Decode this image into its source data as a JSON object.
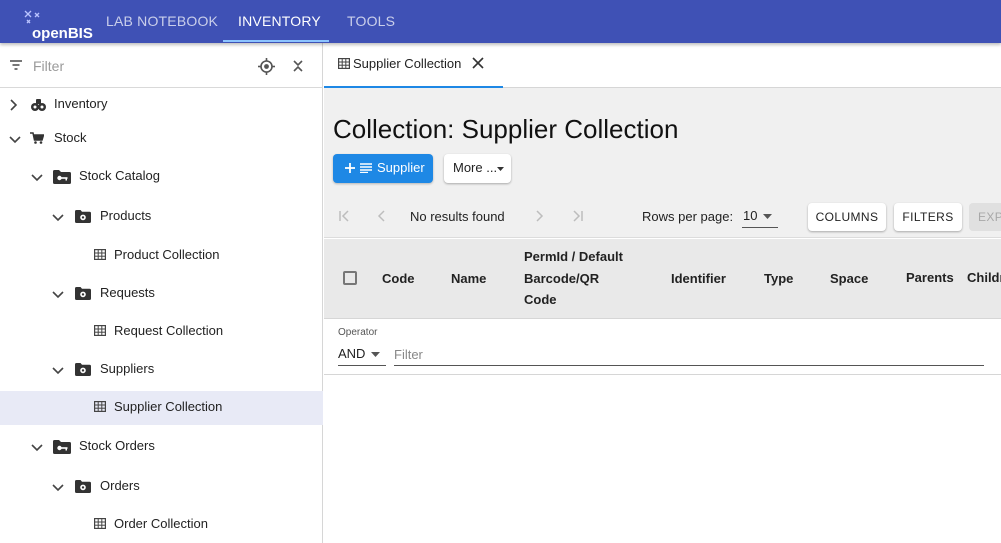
{
  "app": {
    "logo_text": "openBIS",
    "nav": [
      {
        "label": "LAB NOTEBOOK",
        "active": false
      },
      {
        "label": "INVENTORY",
        "active": true
      },
      {
        "label": "TOOLS",
        "active": false
      }
    ]
  },
  "sidebar": {
    "filter_placeholder": "Filter",
    "tree": [
      {
        "label": "Inventory",
        "icon": "flask-group-icon",
        "level": 0,
        "expanded": false
      },
      {
        "label": "Stock",
        "icon": "cart-icon",
        "level": 0,
        "expanded": true
      },
      {
        "label": "Stock Catalog",
        "icon": "folder-key-icon",
        "level": 1,
        "expanded": true
      },
      {
        "label": "Products",
        "icon": "folder-cog-icon",
        "level": 2,
        "expanded": true
      },
      {
        "label": "Product Collection",
        "icon": "table-icon",
        "level": 3
      },
      {
        "label": "Requests",
        "icon": "folder-cog-icon",
        "level": 2,
        "expanded": true
      },
      {
        "label": "Request Collection",
        "icon": "table-icon",
        "level": 3
      },
      {
        "label": "Suppliers",
        "icon": "folder-cog-icon",
        "level": 2,
        "expanded": true
      },
      {
        "label": "Supplier Collection",
        "icon": "table-icon",
        "level": 3,
        "selected": true
      },
      {
        "label": "Stock Orders",
        "icon": "folder-key-icon",
        "level": 1,
        "expanded": true
      },
      {
        "label": "Orders",
        "icon": "folder-cog-icon",
        "level": 2,
        "expanded": true
      },
      {
        "label": "Order Collection",
        "icon": "table-icon",
        "level": 3
      }
    ]
  },
  "tabs": [
    {
      "label": "Supplier Collection",
      "active": true
    }
  ],
  "main": {
    "title": "Collection: Supplier Collection",
    "add_button_label": "Supplier",
    "more_button_label": "More ...",
    "pager": {
      "status": "No results found",
      "rows_per_page_label": "Rows per page:",
      "rows_per_page_value": "10"
    },
    "toolbar": {
      "columns_label": "COLUMNS",
      "filters_label": "FILTERS",
      "export_label": "EXP"
    },
    "table": {
      "columns": [
        "Code",
        "Name",
        "PermId / Default",
        "Barcode/QR",
        "Code",
        "Identifier",
        "Type",
        "Space",
        "Parents",
        "Childr"
      ]
    },
    "filter": {
      "operator_label": "Operator",
      "operator_value": "AND",
      "placeholder": "Filter"
    }
  },
  "colors": {
    "header_bg": "#3f51b5",
    "primary": "#1e88e5",
    "selected_row": "#e8eaf6"
  }
}
